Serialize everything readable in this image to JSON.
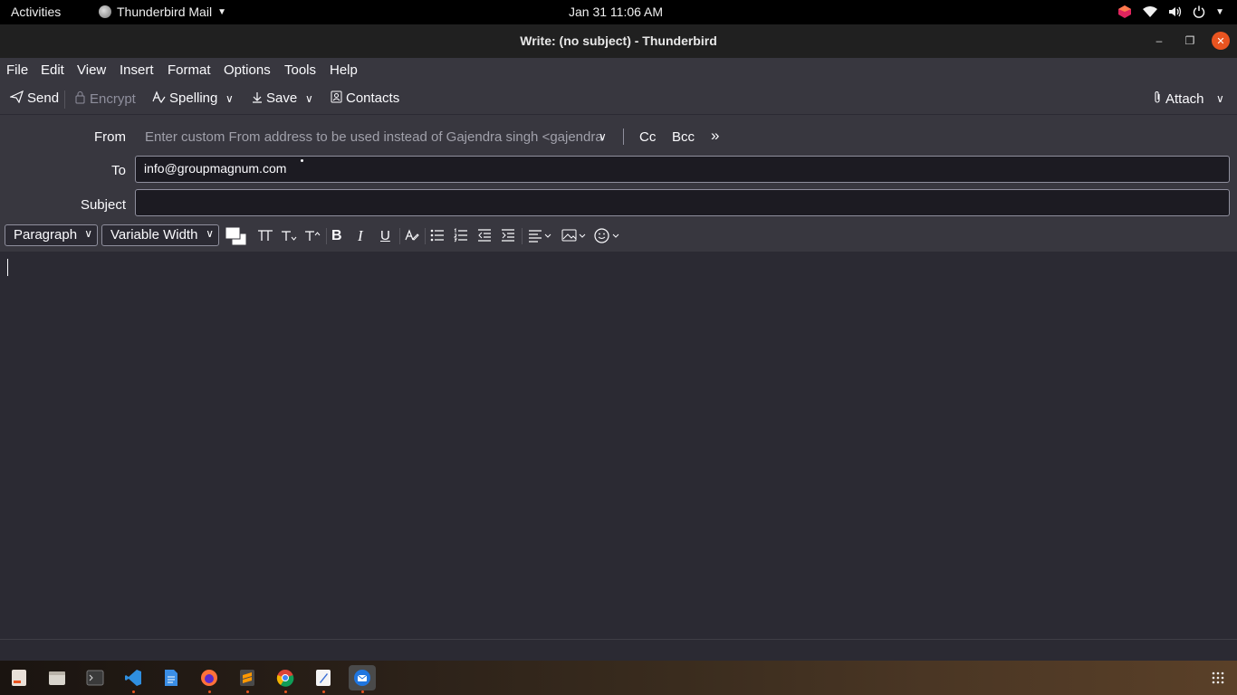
{
  "topbar": {
    "activities": "Activities",
    "app_name": "Thunderbird Mail",
    "clock": "Jan 31  11:06 AM"
  },
  "window": {
    "title": "Write: (no subject) - Thunderbird"
  },
  "menu": [
    "File",
    "Edit",
    "View",
    "Insert",
    "Format",
    "Options",
    "Tools",
    "Help"
  ],
  "toolbar": {
    "send": "Send",
    "encrypt": "Encrypt",
    "spelling": "Spelling",
    "save": "Save",
    "contacts": "Contacts",
    "attach": "Attach"
  },
  "headers": {
    "from_label": "From",
    "from_placeholder": "Enter custom From address to be used instead of Gajendra singh <gajendra",
    "cc": "Cc",
    "bcc": "Bcc",
    "to_label": "To",
    "to_value": "info@groupmagnum.com",
    "subject_label": "Subject",
    "subject_value": ""
  },
  "format": {
    "paragraph": "Paragraph",
    "font": "Variable Width"
  },
  "colors": {
    "accent": "#e95420",
    "background": "#2b2a33",
    "toolbar": "#38373f"
  },
  "dock": [
    "text-editor-icon",
    "files-icon",
    "terminal-icon",
    "vscode-icon",
    "document-icon",
    "firefox-icon",
    "sublime-icon",
    "chrome-icon",
    "gedit-icon",
    "thunderbird-icon"
  ]
}
